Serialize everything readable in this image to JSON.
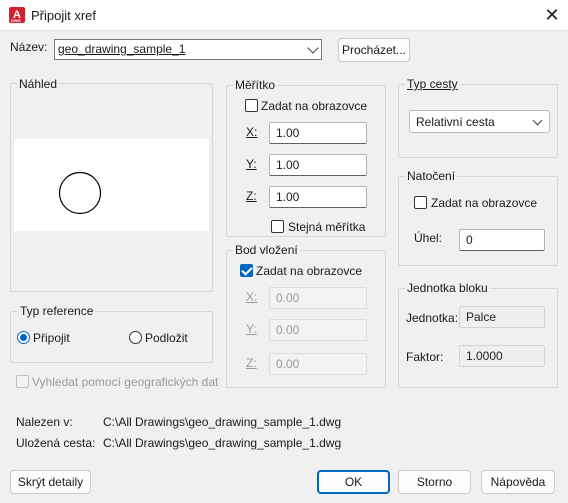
{
  "window": {
    "title": "Připojit xref",
    "app_icon_letter": "A",
    "app_icon_sub": "DWG",
    "close_glyph": "✕"
  },
  "name_row": {
    "label": "Název:",
    "value": "geo_drawing_sample_1",
    "browse_label": "Procházet..."
  },
  "preview": {
    "title": "Náhled"
  },
  "scale": {
    "title": "Měřítko",
    "specify_on_screen": "Zadat na obrazovce",
    "specify_checked": false,
    "x_label": "X:",
    "x_value": "1.00",
    "y_label": "Y:",
    "y_value": "1.00",
    "z_label": "Z:",
    "z_value": "1.00",
    "uniform_label": "Stejná měřítka",
    "uniform_checked": false
  },
  "path_type": {
    "title": "Typ cesty",
    "value": "Relativní cesta"
  },
  "rotation": {
    "title": "Natočení",
    "specify_on_screen": "Zadat na obrazovce",
    "specify_checked": false,
    "angle_label": "Úhel:",
    "angle_value": "0"
  },
  "insertion": {
    "title": "Bod vložení",
    "specify_on_screen": "Zadat na obrazovce",
    "specify_checked": true,
    "x_label": "X:",
    "x_value": "0.00",
    "y_label": "Y:",
    "y_value": "0.00",
    "z_label": "Z:",
    "z_value": "0.00"
  },
  "block_unit": {
    "title": "Jednotka bloku",
    "unit_label": "Jednotka:",
    "unit_value": "Palce",
    "factor_label": "Faktor:",
    "factor_value": "1.0000"
  },
  "reference_type": {
    "title": "Typ reference",
    "attach_label": "Připojit",
    "attach_selected": true,
    "overlay_label": "Podložit",
    "overlay_selected": false
  },
  "geo": {
    "label": "Vyhledat pomocí geografických dat",
    "checked": false
  },
  "found_in": {
    "label": "Nalezen v:",
    "value": "C:\\All Drawings\\geo_drawing_sample_1.dwg"
  },
  "saved_path": {
    "label": "Uložená cesta:",
    "value": "C:\\All Drawings\\geo_drawing_sample_1.dwg"
  },
  "buttons": {
    "hide_details": "Skrýt detaily",
    "ok": "OK",
    "cancel": "Storno",
    "help": "Nápověda"
  },
  "colors": {
    "accent": "#0067c0",
    "dialog_bg": "#f0f0f0",
    "icon_red": "#d0222b"
  }
}
